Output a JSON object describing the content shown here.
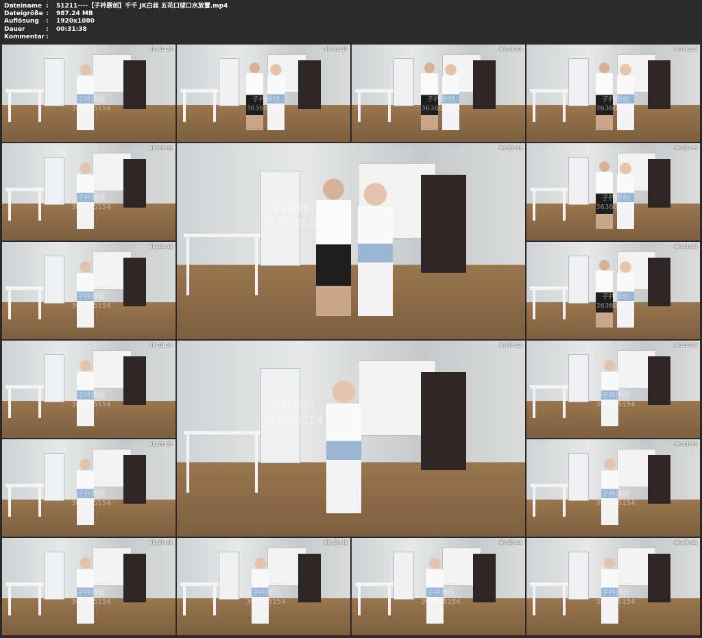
{
  "meta": {
    "rows": [
      {
        "label": "Dateiname",
        "value": "51211----【子衿原创】千千 JK白丝 五花口球口水放置.mp4"
      },
      {
        "label": "Dateigröße",
        "value": "987.24 MB"
      },
      {
        "label": "Auflösung",
        "value": "1920x1080"
      },
      {
        "label": "Dauer",
        "value": "00:31:38"
      },
      {
        "label": "Kommentar",
        "value": ""
      }
    ],
    "separator": ":"
  },
  "watermark": {
    "line1": "子衿原创",
    "line2": "363605154"
  },
  "colors": {
    "background": "#2a2a2a",
    "text": "#ffffff"
  },
  "thumbnails": [
    {
      "timestamp": "00:01:39"
    },
    {
      "timestamp": "00:03:19"
    },
    {
      "timestamp": "00:04:59"
    },
    {
      "timestamp": "00:06:39"
    },
    {
      "timestamp": "00:08:19"
    },
    {
      "timestamp": "00:09:59"
    },
    {
      "timestamp": "00:11:39"
    },
    {
      "timestamp": "00:13:19"
    },
    {
      "timestamp": "00:14:59"
    },
    {
      "timestamp": "00:16:38"
    },
    {
      "timestamp": "00:18:18"
    },
    {
      "timestamp": "00:19:58"
    },
    {
      "timestamp": "00:21:38"
    },
    {
      "timestamp": "00:23:18"
    },
    {
      "timestamp": "00:24:58"
    },
    {
      "timestamp": "00:26:38"
    },
    {
      "timestamp": "00:28:18"
    },
    {
      "timestamp": "00:29:58"
    }
  ]
}
